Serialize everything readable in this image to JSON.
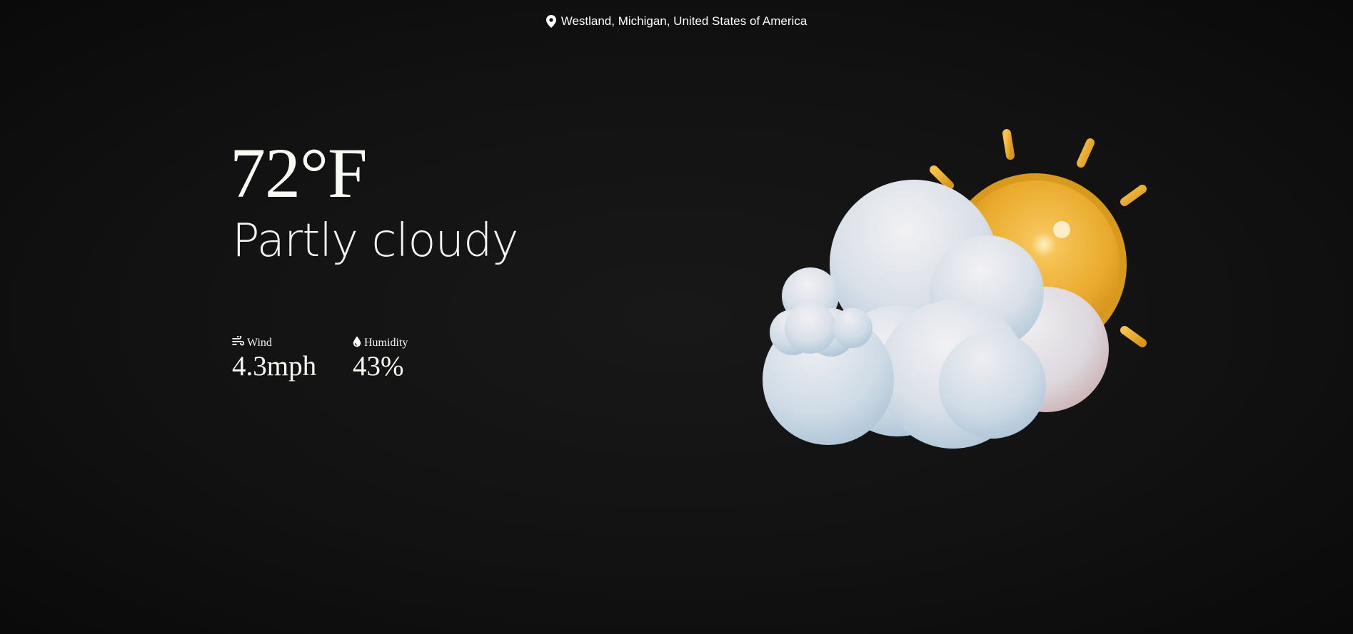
{
  "location": {
    "icon": "map-pin-icon",
    "text": "Westland, Michigan, United States of America"
  },
  "current": {
    "temperature": "72°F",
    "condition": "Partly cloudy"
  },
  "stats": {
    "wind": {
      "icon": "wind-icon",
      "label": "Wind",
      "value": "4.3mph"
    },
    "humidity": {
      "icon": "water-drop-icon",
      "label": "Humidity",
      "value": "43%"
    }
  },
  "illustration": {
    "icon": "partly-cloudy-icon"
  },
  "colors": {
    "background": "#121212",
    "text": "#ffffff",
    "sun": "#f0b42c",
    "cloud": "#dfe6ee"
  }
}
